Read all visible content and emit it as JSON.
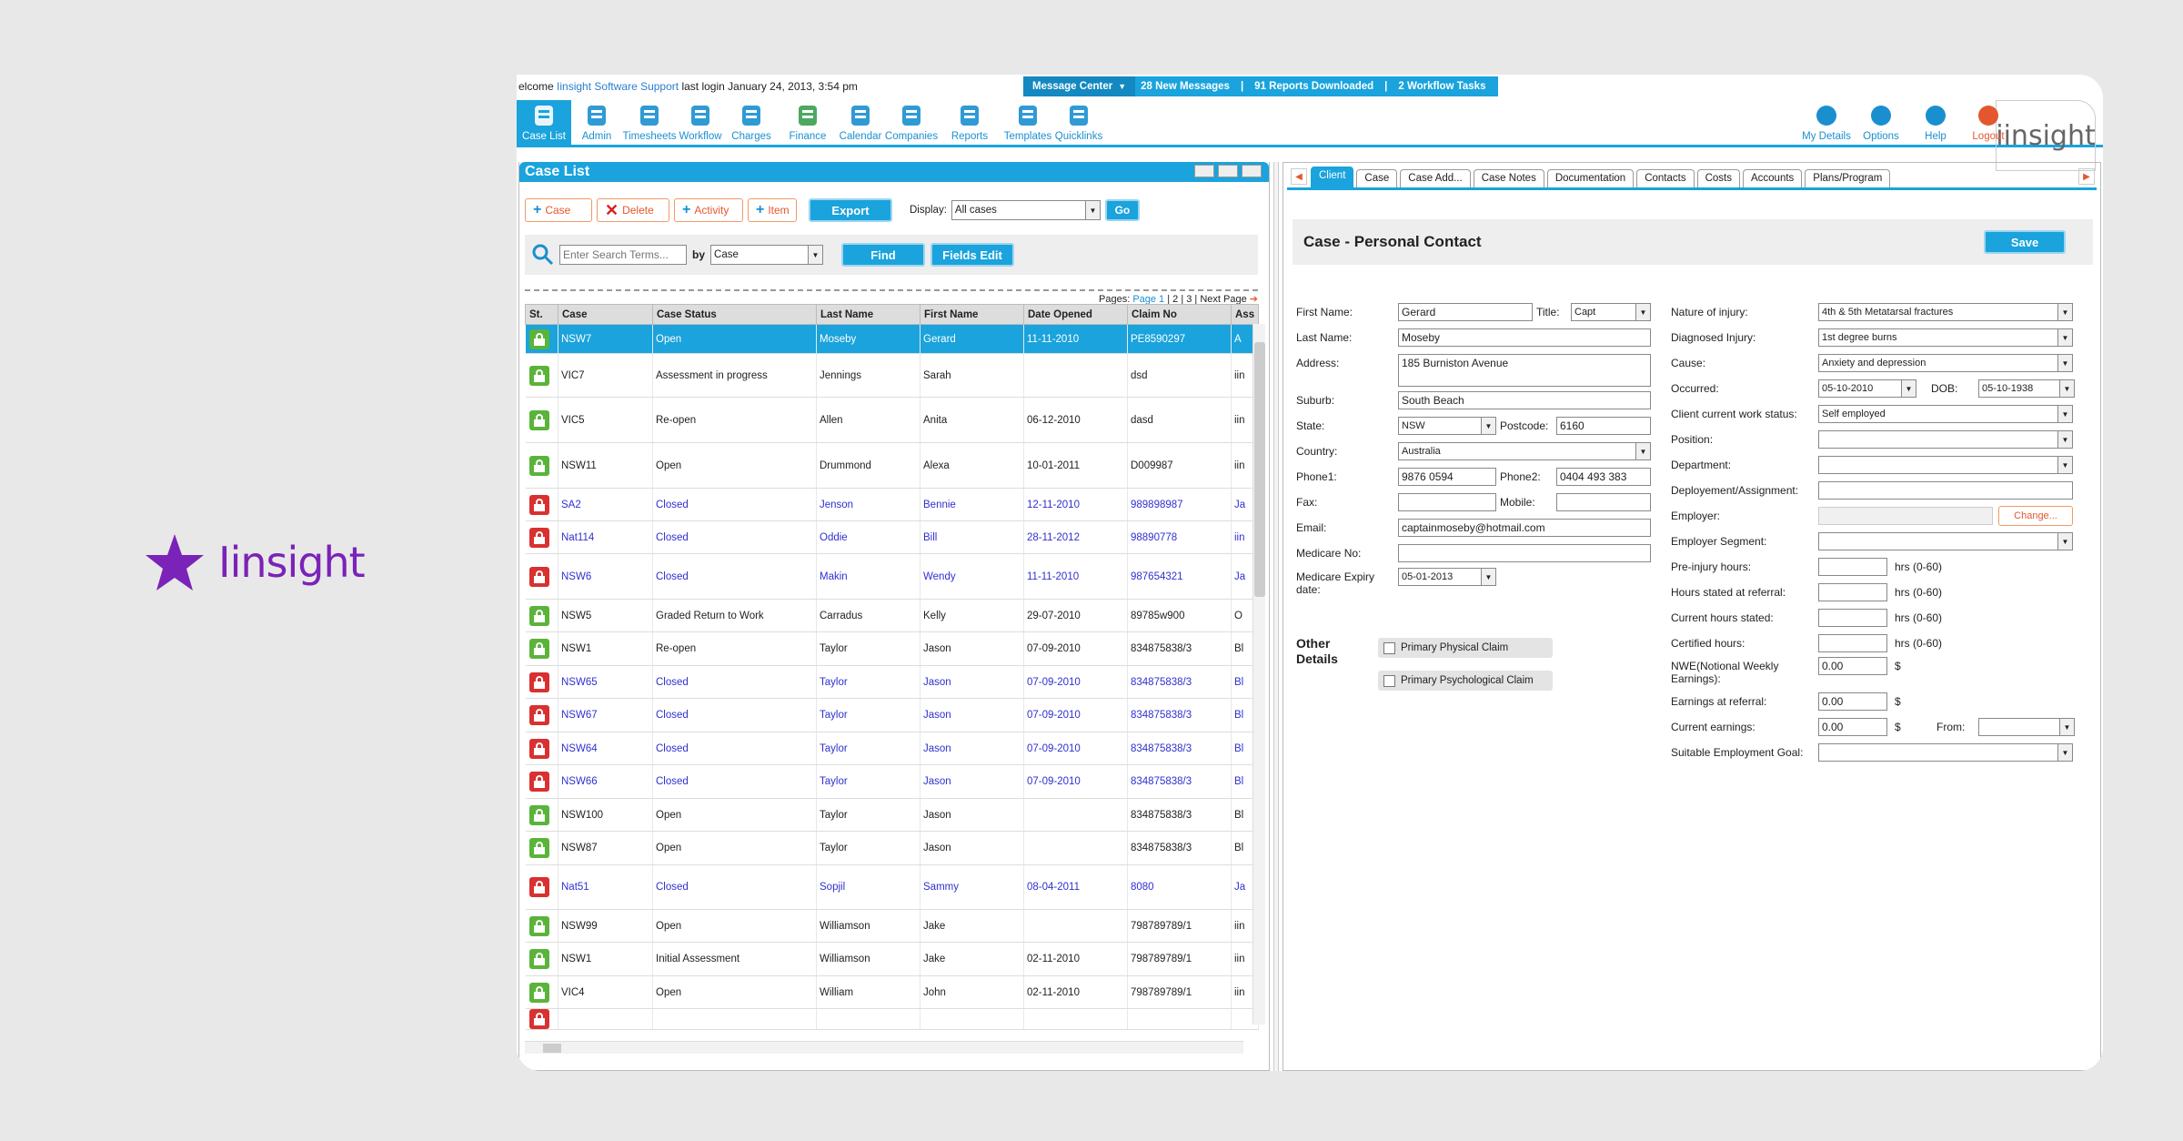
{
  "brand": {
    "name": "Iinsight"
  },
  "topbar": {
    "welcome_prefix": "elcome ",
    "user": "Iinsight Software Support",
    "last_login": " last login January 24, 2013, 3:54 pm",
    "message_center": "Message Center",
    "new_messages": "28  New Messages",
    "reports_downloaded": "91  Reports Downloaded",
    "workflow_tasks": "2  Workflow Tasks"
  },
  "toolbar": {
    "items": [
      {
        "label": "Case List",
        "icon": "person-list-icon"
      },
      {
        "label": "Admin",
        "icon": "admin-person-icon"
      },
      {
        "label": "Timesheets",
        "icon": "clock-icon"
      },
      {
        "label": "Workflow",
        "icon": "workflow-icon"
      },
      {
        "label": "Charges",
        "icon": "dollar-icon"
      },
      {
        "label": "Finance",
        "icon": "calculator-icon"
      },
      {
        "label": "Calendar",
        "icon": "calendar-icon"
      },
      {
        "label": "Companies",
        "icon": "briefcase-icon"
      },
      {
        "label": "Reports",
        "icon": "report-icon"
      },
      {
        "label": "Templates",
        "icon": "template-icon"
      },
      {
        "label": "Quicklinks",
        "icon": "arrow-down-icon"
      }
    ],
    "right": [
      {
        "label": "My Details",
        "icon": "person-icon"
      },
      {
        "label": "Options",
        "icon": "gear-icon"
      },
      {
        "label": "Help",
        "icon": "info-icon"
      },
      {
        "label": "Logout",
        "icon": "logout-icon"
      }
    ],
    "logo": "iinsight"
  },
  "caselist": {
    "title": "Case List",
    "buttons": {
      "case": "Case",
      "delete": "Delete",
      "activity": "Activity",
      "item": "Item",
      "export": "Export",
      "display_label": "Display:",
      "display_value": "All cases",
      "go": "Go"
    },
    "search": {
      "placeholder": "Enter Search Terms...",
      "by": "by",
      "by_value": "Case",
      "find": "Find",
      "fields_edit": "Fields Edit"
    },
    "pages": {
      "label": "Pages:",
      "p1": "Page 1",
      "rest": " | 2 | 3 |",
      "next": "Next Page"
    },
    "columns": [
      "St.",
      "Case",
      "Case Status",
      "Last Name",
      "First Name",
      "Date Opened",
      "Claim No",
      "Ass"
    ],
    "rows": [
      {
        "st": "g",
        "case": "NSW7",
        "status": "Open",
        "last": "Moseby",
        "first": "Gerard",
        "date": "11-11-2010",
        "claim": "PE8590297",
        "ass": "A",
        "sel": true,
        "h": 32
      },
      {
        "st": "g",
        "case": "VIC7",
        "status": "Assessment in progress",
        "last": "Jennings",
        "first": "Sarah",
        "date": "",
        "claim": "dsd",
        "ass": "iin",
        "h": 48
      },
      {
        "st": "g",
        "case": "VIC5",
        "status": "Re-open",
        "last": "Allen",
        "first": "Anita",
        "date": "06-12-2010",
        "claim": "dasd",
        "ass": "iin",
        "h": 50
      },
      {
        "st": "g",
        "case": "NSW11",
        "status": "Open",
        "last": "Drummond",
        "first": "Alexa",
        "date": "10-01-2011",
        "claim": "D009987",
        "ass": "iin",
        "h": 50
      },
      {
        "st": "r",
        "case": "SA2",
        "status": "Closed",
        "last": "Jenson",
        "first": "Bennie",
        "date": "12-11-2010",
        "claim": "989898987",
        "ass": "Ja",
        "closed": true,
        "h": 36
      },
      {
        "st": "r",
        "case": "Nat114",
        "status": "Closed",
        "last": "Oddie",
        "first": "Bill",
        "date": "28-11-2012",
        "claim": "98890778",
        "ass": "iin",
        "closed": true,
        "h": 36
      },
      {
        "st": "r",
        "case": "NSW6",
        "status": "Closed",
        "last": "Makin",
        "first": "Wendy",
        "date": "11-11-2010",
        "claim": "987654321",
        "ass": "Ja",
        "closed": true,
        "h": 50
      },
      {
        "st": "g",
        "case": "NSW5",
        "status": "Graded Return to Work",
        "last": "Carradus",
        "first": "Kelly",
        "date": "29-07-2010",
        "claim": "89785w900",
        "ass": "O",
        "h": 36
      },
      {
        "st": "g",
        "case": "NSW1",
        "status": "Re-open",
        "last": "Taylor",
        "first": "Jason",
        "date": "07-09-2010",
        "claim": "834875838/3",
        "ass": "Bl",
        "h": 37
      },
      {
        "st": "r",
        "case": "NSW65",
        "status": "Closed",
        "last": "Taylor",
        "first": "Jason",
        "date": "07-09-2010",
        "claim": "834875838/3",
        "ass": "Bl",
        "closed": true,
        "h": 36
      },
      {
        "st": "r",
        "case": "NSW67",
        "status": "Closed",
        "last": "Taylor",
        "first": "Jason",
        "date": "07-09-2010",
        "claim": "834875838/3",
        "ass": "Bl",
        "closed": true,
        "h": 37
      },
      {
        "st": "r",
        "case": "NSW64",
        "status": "Closed",
        "last": "Taylor",
        "first": "Jason",
        "date": "07-09-2010",
        "claim": "834875838/3",
        "ass": "Bl",
        "closed": true,
        "h": 36
      },
      {
        "st": "r",
        "case": "NSW66",
        "status": "Closed",
        "last": "Taylor",
        "first": "Jason",
        "date": "07-09-2010",
        "claim": "834875838/3",
        "ass": "Bl",
        "closed": true,
        "h": 37
      },
      {
        "st": "g",
        "case": "NSW100",
        "status": "Open",
        "last": "Taylor",
        "first": "Jason",
        "date": "",
        "claim": "834875838/3",
        "ass": "Bl",
        "h": 36
      },
      {
        "st": "g",
        "case": "NSW87",
        "status": "Open",
        "last": "Taylor",
        "first": "Jason",
        "date": "",
        "claim": "834875838/3",
        "ass": "Bl",
        "h": 37
      },
      {
        "st": "r",
        "case": "Nat51",
        "status": "Closed",
        "last": "Sopjil",
        "first": "Sammy",
        "date": "08-04-2011",
        "claim": "8080",
        "ass": "Ja",
        "closed": true,
        "h": 49
      },
      {
        "st": "g",
        "case": "NSW99",
        "status": "Open",
        "last": "Williamson",
        "first": "Jake",
        "date": "",
        "claim": "798789789/1",
        "ass": "iin",
        "h": 36
      },
      {
        "st": "g",
        "case": "NSW1",
        "status": "Initial Assessment",
        "last": "Williamson",
        "first": "Jake",
        "date": "02-11-2010",
        "claim": "798789789/1",
        "ass": "iin",
        "h": 37
      },
      {
        "st": "g",
        "case": "VIC4",
        "status": "Open",
        "last": "William",
        "first": "John",
        "date": "02-11-2010",
        "claim": "798789789/1",
        "ass": "iin",
        "h": 36
      },
      {
        "st": "r",
        "case": "",
        "status": "",
        "last": "",
        "first": "",
        "date": "",
        "claim": "",
        "ass": "",
        "h": 20
      }
    ]
  },
  "detail": {
    "tabs": [
      "Client",
      "Case",
      "Case Add...",
      "Case Notes",
      "Documentation",
      "Contacts",
      "Costs",
      "Accounts",
      "Plans/Program"
    ],
    "heading": "Case - Personal Contact",
    "save": "Save",
    "labels": {
      "first_name": "First Name:",
      "title": "Title:",
      "last_name": "Last Name:",
      "address": "Address:",
      "suburb": "Suburb:",
      "state": "State:",
      "postcode": "Postcode:",
      "country": "Country:",
      "phone1": "Phone1:",
      "phone2": "Phone2:",
      "fax": "Fax:",
      "mobile": "Mobile:",
      "email": "Email:",
      "medicare": "Medicare No:",
      "medicare_exp": "Medicare Expiry",
      "medicare_exp2": "date:",
      "other": "Other",
      "details": "Details",
      "nature": "Nature of injury:",
      "diag": "Diagnosed Injury:",
      "cause": "Cause:",
      "occurred": "Occurred:",
      "dob": "DOB:",
      "work_status": "Client current work status:",
      "position": "Position:",
      "department": "Department:",
      "deploy": "Deployement/Assignment:",
      "employer": "Employer:",
      "emp_segment": "Employer Segment:",
      "pre_injury": "Pre-injury hours:",
      "hrs_referral": "Hours stated at referral:",
      "hrs_current": "Current hours stated:",
      "hrs_cert": "Certified hours:",
      "nwe": "NWE(Notional Weekly",
      "nwe2": "Earnings):",
      "earn_ref": "Earnings at referral:",
      "earn_cur": "Current earnings:",
      "from": "From:",
      "suitable": "Suitable Employment Goal:",
      "hrs_unit": "hrs (0-60)",
      "dollar": "$"
    },
    "values": {
      "first_name": "Gerard",
      "title": "Capt",
      "last_name": "Moseby",
      "address": "185 Burniston Avenue",
      "suburb": "South Beach",
      "state": "NSW",
      "postcode": "6160",
      "country": "Australia",
      "phone1": "9876 0594",
      "phone2": "0404 493 383",
      "email": "captainmoseby@hotmail.com",
      "medicare_exp": "05-01-2013",
      "nature": "4th & 5th Metatarsal fractures",
      "diag": "1st degree burns",
      "cause": "Anxiety and depression",
      "occurred": "05-10-2010",
      "dob": "05-10-1938",
      "work_status": "Self employed",
      "nwe": "0.00",
      "earn_ref": "0.00",
      "earn_cur": "0.00"
    },
    "checks": {
      "physical": "Primary Physical Claim",
      "psych": "Primary Psychological Claim"
    },
    "change": "Change..."
  },
  "colors": {
    "accent": "#1aa3dc",
    "brand": "#7b22b8",
    "closed_text": "#3030d0",
    "orange": "#e4572e"
  }
}
